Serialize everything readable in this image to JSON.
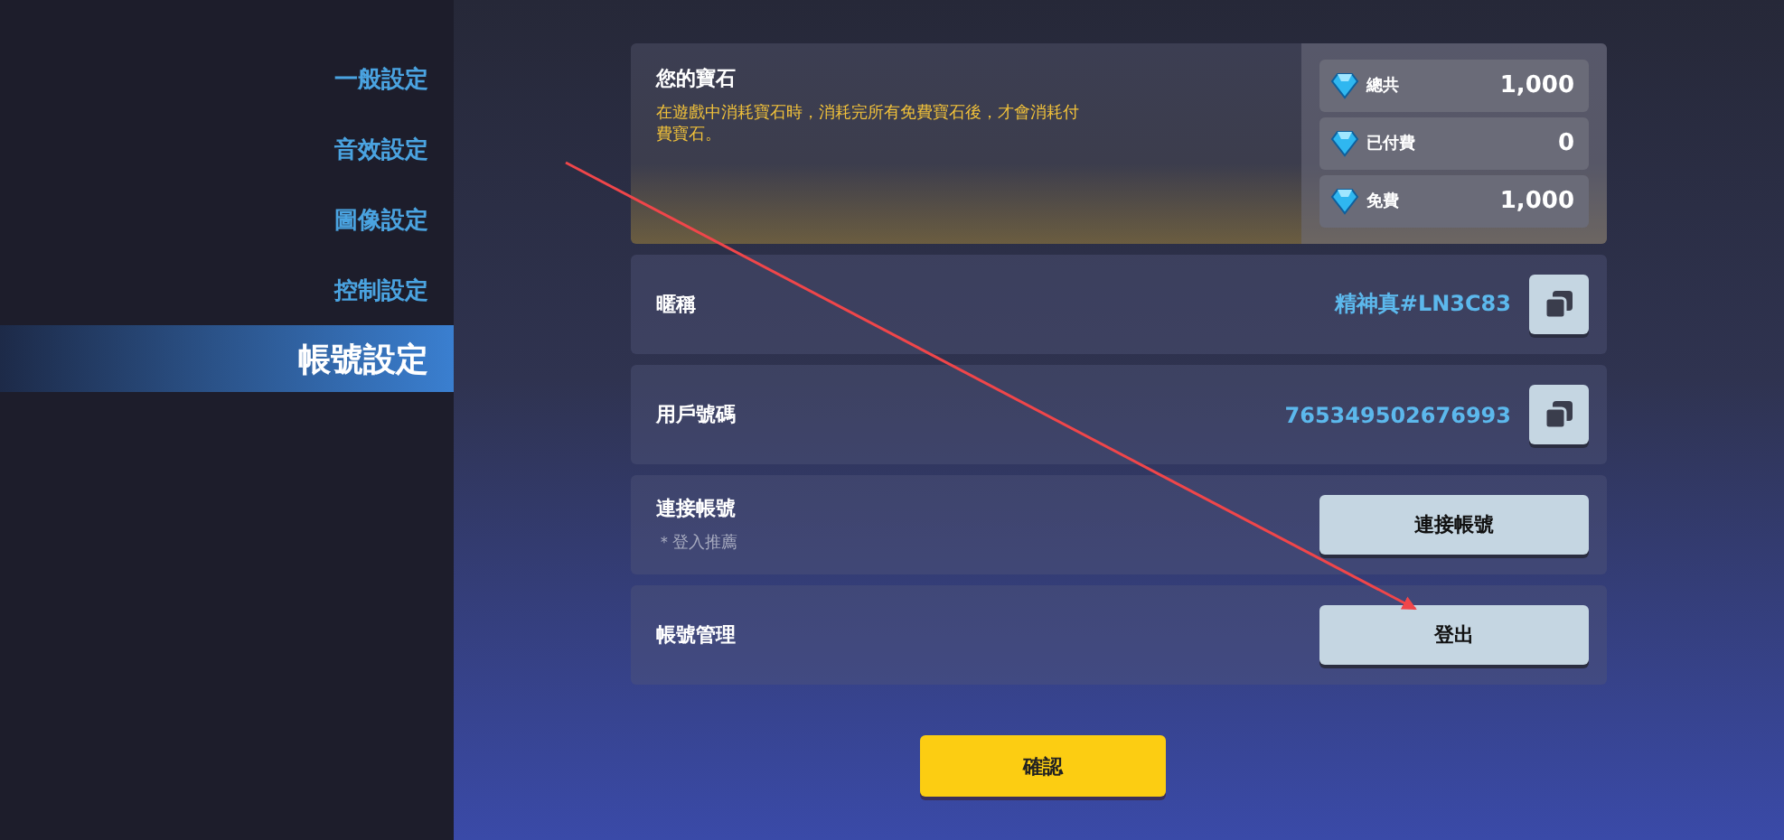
{
  "sidebar": {
    "items": [
      {
        "label": "一般設定",
        "selected": false
      },
      {
        "label": "音效設定",
        "selected": false
      },
      {
        "label": "圖像設定",
        "selected": false
      },
      {
        "label": "控制設定",
        "selected": false
      },
      {
        "label": "帳號設定",
        "selected": true
      }
    ]
  },
  "gems": {
    "title": "您的寶石",
    "note": "在遊戲中消耗寶石時，消耗完所有免費寶石後，才會消耗付費寶石。",
    "entries": [
      {
        "label": "總共",
        "value": "1,000"
      },
      {
        "label": "已付費",
        "value": "0"
      },
      {
        "label": "免費",
        "value": "1,000"
      }
    ]
  },
  "rows": [
    {
      "kind": "copy",
      "label": "暱稱",
      "value": "精神真#LN3C83"
    },
    {
      "kind": "copy",
      "label": "用戶號碼",
      "value": "765349502676993"
    },
    {
      "kind": "button",
      "label": "連接帳號",
      "sublabel": "＊登入推薦",
      "button": "連接帳號"
    },
    {
      "kind": "button",
      "label": "帳號管理",
      "button": "登出"
    }
  ],
  "confirm_button": "確認"
}
